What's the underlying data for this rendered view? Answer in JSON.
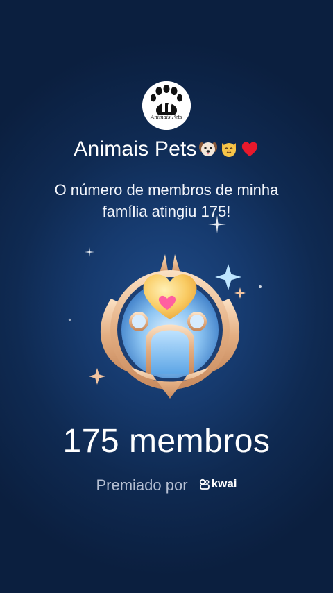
{
  "group": {
    "name": "Animais Pets",
    "logo_text": "Animais Pets"
  },
  "message": "O número de membros de minha família atingiu 175!",
  "members_count": "175 membros",
  "awarded_by": {
    "label": "Premiado por",
    "brand": "kwai"
  },
  "icons": [
    "paw-logo-icon",
    "dog-emoji-icon",
    "cat-emoji-icon",
    "red-heart-emoji-icon",
    "sparkle-icon",
    "kwai-logo-icon"
  ],
  "colors": {
    "background_dark": "#0b1f3f",
    "background_mid": "#1f4a86",
    "badge_gold": "#e7b98f",
    "heart_yellow": "#f7c25a",
    "heart_pink": "#ff5fa0"
  }
}
